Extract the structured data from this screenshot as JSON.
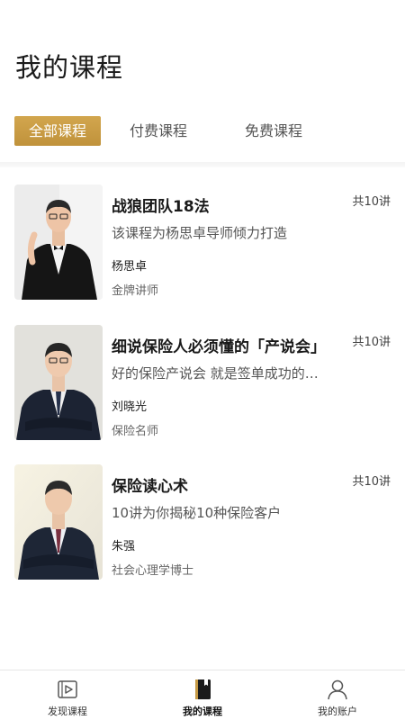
{
  "header": {
    "title": "我的课程"
  },
  "tabs": [
    {
      "label": "全部课程",
      "active": true
    },
    {
      "label": "付费课程",
      "active": false
    },
    {
      "label": "免费课程",
      "active": false
    }
  ],
  "courses": [
    {
      "title": "战狼团队18法",
      "count": "共10讲",
      "desc": "该课程为杨思卓导师倾力打造",
      "teacher": "杨思卓",
      "role": "金牌讲师"
    },
    {
      "title": "细说保险人必须懂的「产说会」",
      "count": "共10讲",
      "desc": "好的保险产说会 就是签单成功的…",
      "teacher": "刘晓光",
      "role": "保险名师"
    },
    {
      "title": "保险读心术",
      "count": "共10讲",
      "desc": "10讲为你揭秘10种保险客户",
      "teacher": "朱强",
      "role": "社会心理学博士"
    }
  ],
  "tabbar": [
    {
      "label": "发现课程",
      "icon": "video-play-icon"
    },
    {
      "label": "我的课程",
      "icon": "book-icon",
      "active": true
    },
    {
      "label": "我的账户",
      "icon": "user-icon"
    }
  ],
  "colors": {
    "accent": "#c69a45"
  }
}
